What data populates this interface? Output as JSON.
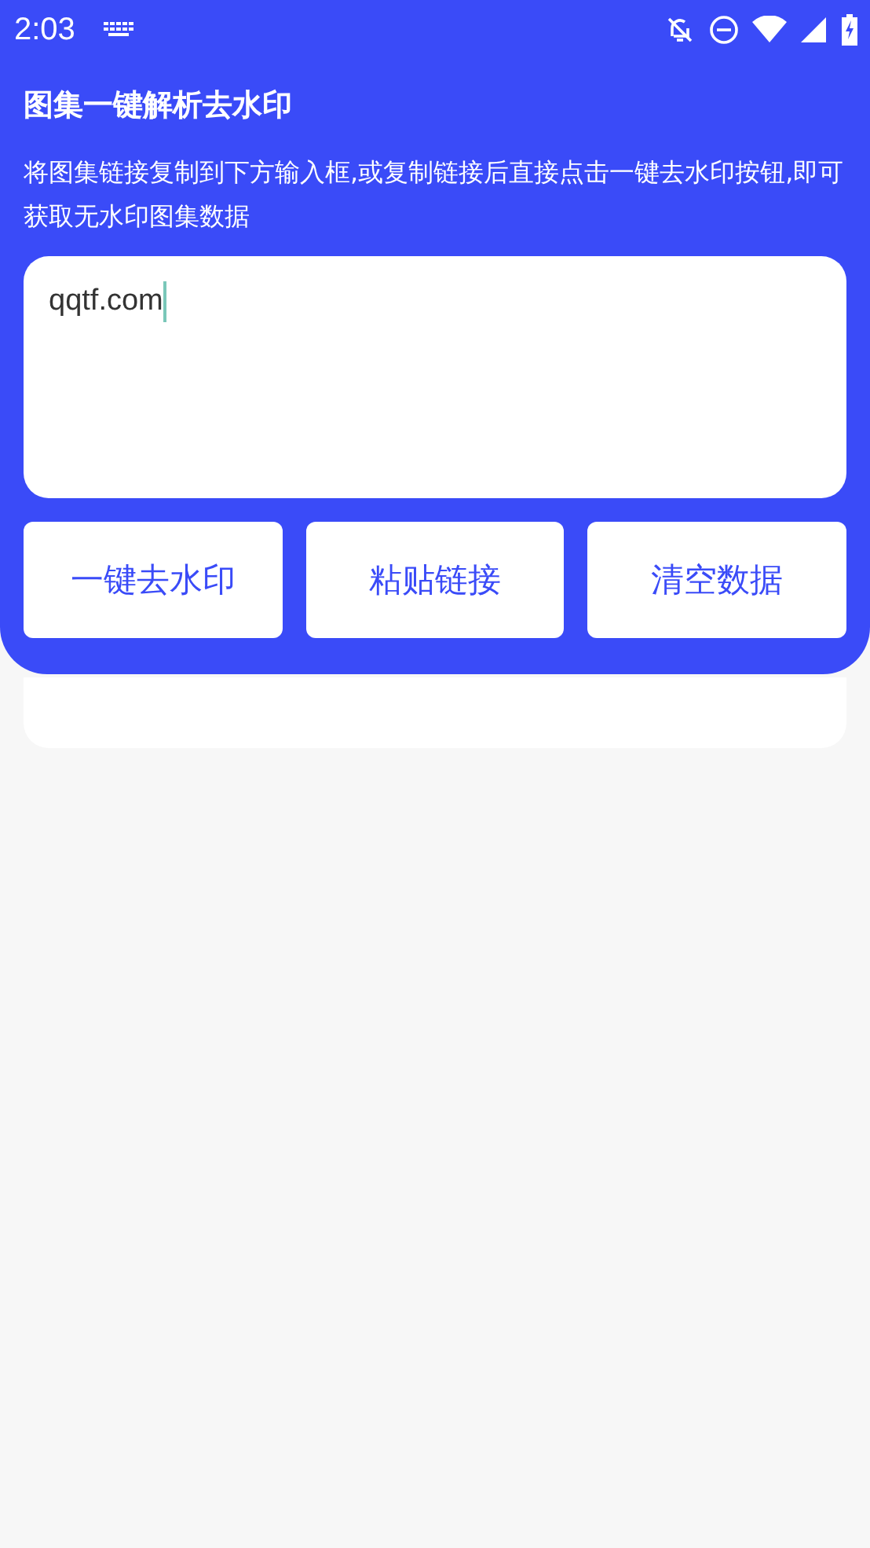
{
  "status_bar": {
    "time": "2:03"
  },
  "header": {
    "title": "图集一键解析去水印",
    "description": "将图集链接复制到下方输入框,或复制链接后直接点击一键去水印按钮,即可获取无水印图集数据"
  },
  "link_field": {
    "value": "qqtf.com",
    "focused": true
  },
  "buttons": [
    "一键去水印",
    "粘贴链接",
    "清空数据"
  ]
}
